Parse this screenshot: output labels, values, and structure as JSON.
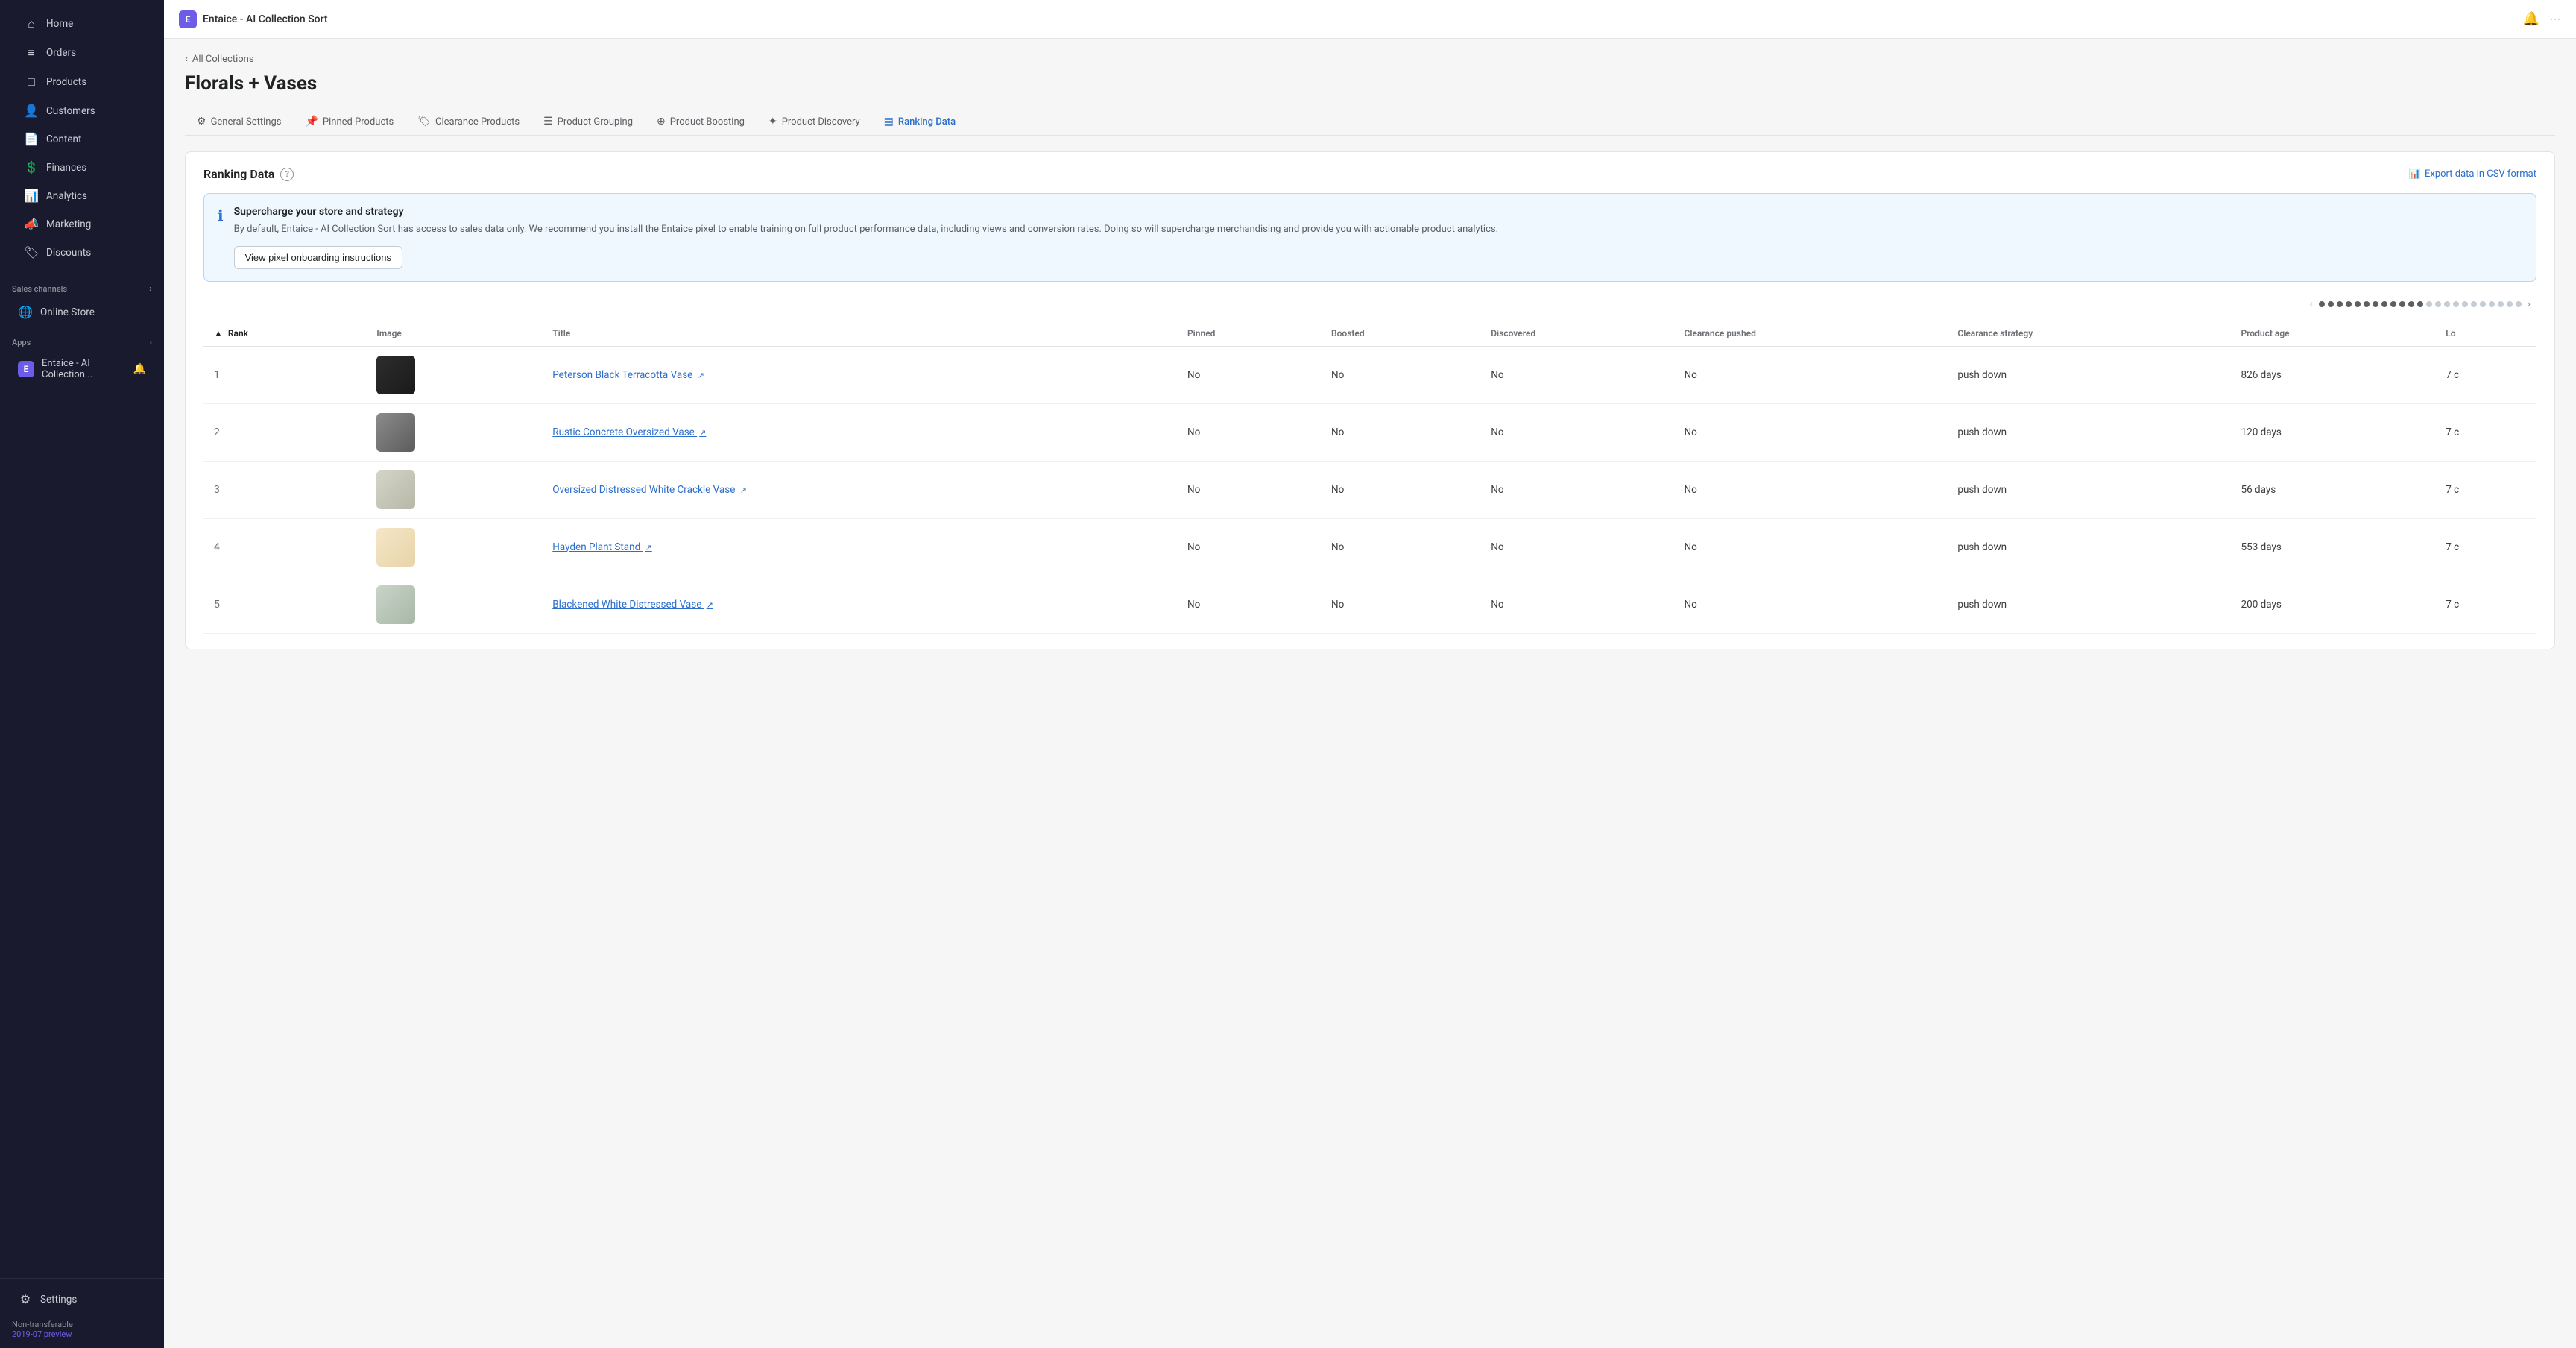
{
  "app": {
    "title": "Entaice - AI Collection Sort",
    "badge_letter": "E"
  },
  "topbar": {
    "bell_icon": "🔔",
    "more_icon": "···"
  },
  "sidebar": {
    "nav_items": [
      {
        "id": "home",
        "label": "Home",
        "icon": "⌂"
      },
      {
        "id": "orders",
        "label": "Orders",
        "icon": "📋"
      },
      {
        "id": "products",
        "label": "Products",
        "icon": "📦"
      },
      {
        "id": "customers",
        "label": "Customers",
        "icon": "👤"
      },
      {
        "id": "content",
        "label": "Content",
        "icon": "📄"
      },
      {
        "id": "finances",
        "label": "Finances",
        "icon": "💰"
      },
      {
        "id": "analytics",
        "label": "Analytics",
        "icon": "📊"
      },
      {
        "id": "marketing",
        "label": "Marketing",
        "icon": "📣"
      },
      {
        "id": "discounts",
        "label": "Discounts",
        "icon": "🏷"
      }
    ],
    "sections": [
      {
        "label": "Sales channels",
        "items": [
          {
            "id": "online-store",
            "label": "Online Store",
            "icon": "🌐"
          }
        ]
      },
      {
        "label": "Apps",
        "items": [
          {
            "id": "entaice-app",
            "label": "Entaice - AI Collection...",
            "icon": "E",
            "has_bell": true
          }
        ]
      }
    ],
    "settings_label": "Settings",
    "non_transferable_label": "Non-transferable",
    "preview_label": "2019-07 preview"
  },
  "breadcrumb": {
    "text": "All Collections",
    "arrow": "‹"
  },
  "page": {
    "title": "Florals + Vases"
  },
  "tabs": [
    {
      "id": "general-settings",
      "label": "General Settings",
      "icon": "⚙",
      "active": false
    },
    {
      "id": "pinned-products",
      "label": "Pinned Products",
      "icon": "📌",
      "active": false
    },
    {
      "id": "clearance-products",
      "label": "Clearance Products",
      "icon": "🏷",
      "active": false
    },
    {
      "id": "product-grouping",
      "label": "Product Grouping",
      "icon": "☰",
      "active": false
    },
    {
      "id": "product-boosting",
      "label": "Product Boosting",
      "icon": "⊕",
      "active": false
    },
    {
      "id": "product-discovery",
      "label": "Product Discovery",
      "icon": "✦",
      "active": false
    },
    {
      "id": "ranking-data",
      "label": "Ranking Data",
      "icon": "▤",
      "active": true
    }
  ],
  "ranking_data": {
    "title": "Ranking Data",
    "export_label": "Export data in CSV format",
    "export_icon": "📊",
    "info_banner": {
      "title": "Supercharge your store and strategy",
      "body": "By default, Entaice - AI Collection Sort has access to sales data only. We recommend you install the Entaice pixel to enable training on full product performance data, including views and conversion rates. Doing so will supercharge merchandising and provide you with actionable product analytics.",
      "button_label": "View pixel onboarding instructions"
    },
    "pagination": {
      "prev_arrow": "‹",
      "next_arrow": "›",
      "dots": [
        {
          "active": true
        },
        {
          "active": true
        },
        {
          "active": true
        },
        {
          "active": true
        },
        {
          "active": true
        },
        {
          "active": true
        },
        {
          "active": true
        },
        {
          "active": true
        },
        {
          "active": true
        },
        {
          "active": true
        },
        {
          "active": true
        },
        {
          "active": true
        },
        {
          "active": false
        },
        {
          "active": false
        },
        {
          "active": false
        },
        {
          "active": false
        },
        {
          "active": false
        },
        {
          "active": false
        },
        {
          "active": false
        },
        {
          "active": false
        },
        {
          "active": false
        },
        {
          "active": false
        },
        {
          "active": false
        }
      ]
    },
    "table": {
      "columns": [
        {
          "id": "rank",
          "label": "Rank",
          "sortable": true,
          "sorted": true
        },
        {
          "id": "image",
          "label": "Image",
          "sortable": false
        },
        {
          "id": "title",
          "label": "Title",
          "sortable": false
        },
        {
          "id": "pinned",
          "label": "Pinned",
          "sortable": false
        },
        {
          "id": "boosted",
          "label": "Boosted",
          "sortable": false
        },
        {
          "id": "discovered",
          "label": "Discovered",
          "sortable": false
        },
        {
          "id": "clearance_pushed",
          "label": "Clearance pushed",
          "sortable": false
        },
        {
          "id": "clearance_strategy",
          "label": "Clearance strategy",
          "sortable": false
        },
        {
          "id": "product_age",
          "label": "Product age",
          "sortable": false
        },
        {
          "id": "lo",
          "label": "Lo",
          "sortable": false
        }
      ],
      "rows": [
        {
          "rank": "1",
          "image_style": "img-vase-1",
          "image_emoji": "🏺",
          "title": "Peterson Black Terracotta Vase",
          "pinned": "No",
          "boosted": "No",
          "discovered": "No",
          "clearance_pushed": "No",
          "clearance_strategy": "push down",
          "product_age": "826 days",
          "lo": "7 c"
        },
        {
          "rank": "2",
          "image_style": "img-vase-2",
          "image_emoji": "🪴",
          "title": "Rustic Concrete Oversized Vase",
          "pinned": "No",
          "boosted": "No",
          "discovered": "No",
          "clearance_pushed": "No",
          "clearance_strategy": "push down",
          "product_age": "120 days",
          "lo": "7 c"
        },
        {
          "rank": "3",
          "image_style": "img-vase-3",
          "image_emoji": "🌿",
          "title": "Oversized Distressed White Crackle Vase",
          "pinned": "No",
          "boosted": "No",
          "discovered": "No",
          "clearance_pushed": "No",
          "clearance_strategy": "push down",
          "product_age": "56 days",
          "lo": "7 c"
        },
        {
          "rank": "4",
          "image_style": "img-plant-4",
          "image_emoji": "🌱",
          "title": "Hayden Plant Stand",
          "pinned": "No",
          "boosted": "No",
          "discovered": "No",
          "clearance_pushed": "No",
          "clearance_strategy": "push down",
          "product_age": "553 days",
          "lo": "7 c"
        },
        {
          "rank": "5",
          "image_style": "img-plant-5",
          "image_emoji": "🌸",
          "title": "Blackened White Distressed Vase",
          "pinned": "No",
          "boosted": "No",
          "discovered": "No",
          "clearance_pushed": "No",
          "clearance_strategy": "push down",
          "product_age": "200 days",
          "lo": "7 c"
        }
      ]
    }
  }
}
